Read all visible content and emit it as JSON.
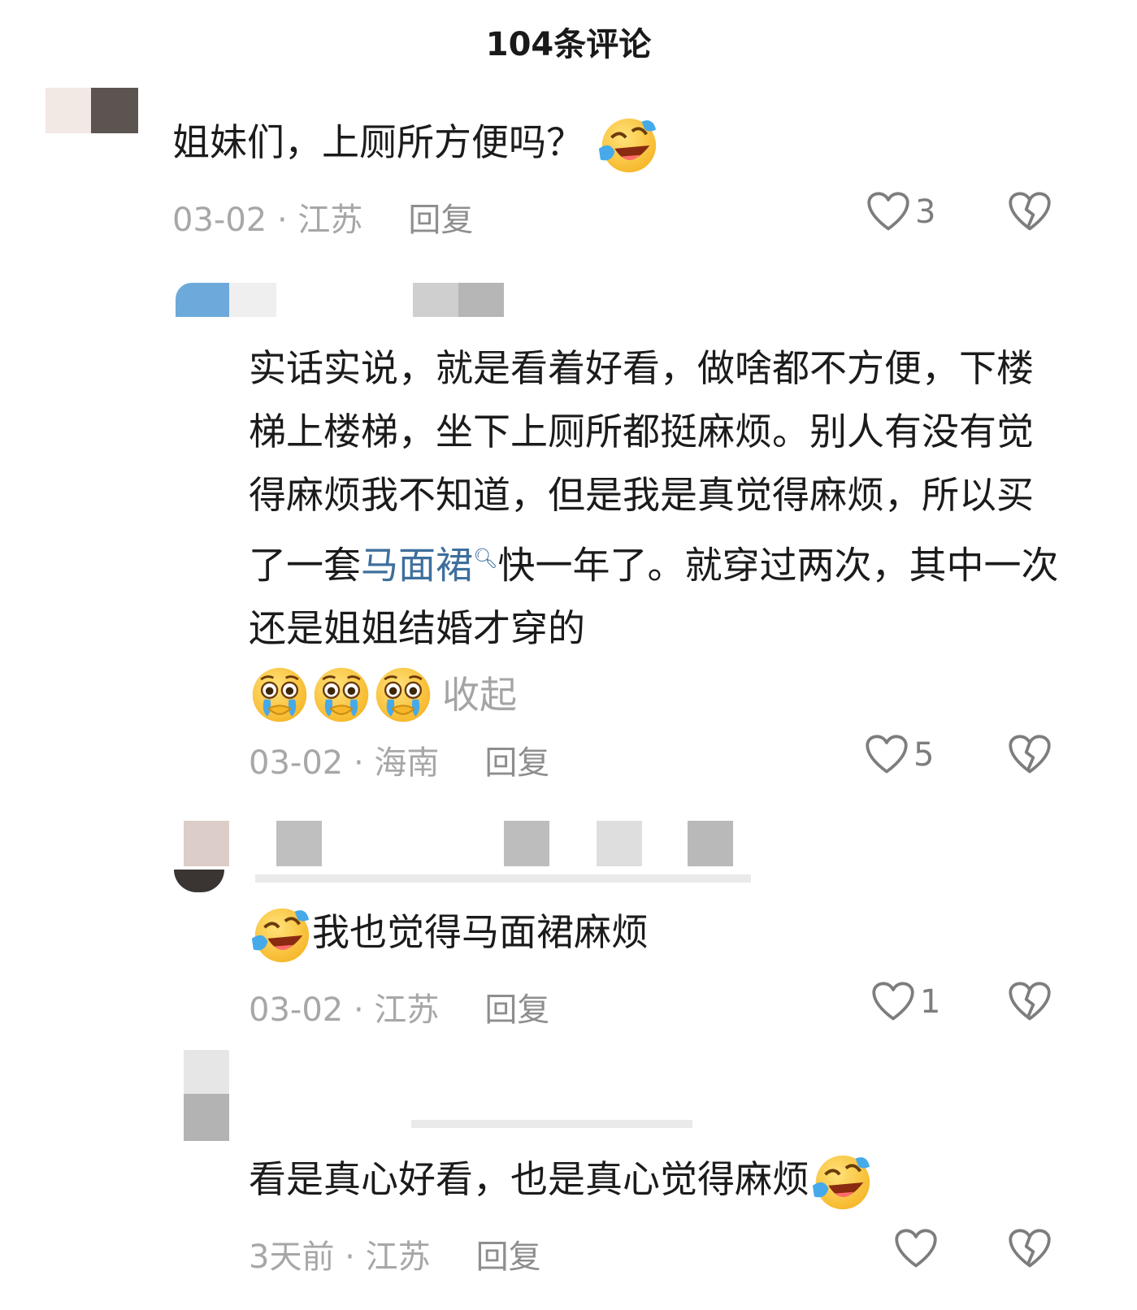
{
  "header": {
    "title": "104条评论"
  },
  "comments": [
    {
      "text": "姐妹们，上厕所方便吗？",
      "date": "03-02",
      "location": "江苏",
      "reply_label": "回复",
      "likes": "3",
      "emoji_icon": "laugh-cry-emoji-icon"
    },
    {
      "text_before": "实话实说，就是看着好看，做啥都不方便，下楼梯上楼梯，坐下上厕所都挺麻烦。别人有没有觉得麻烦我不知道，但是我是真觉得麻烦，所以买了一套",
      "link": "马面裙",
      "text_after": "快一年了。就穿过两次，其中一次还是姐姐结婚才穿的",
      "collapse_label": "收起",
      "date": "03-02",
      "location": "海南",
      "reply_label": "回复",
      "likes": "5",
      "emoji_icon": "pleading-cry-emoji-icon"
    },
    {
      "text": "我也觉得马面裙麻烦",
      "date": "03-02",
      "location": "江苏",
      "reply_label": "回复",
      "likes": "1",
      "emoji_icon": "laugh-cry-emoji-icon"
    },
    {
      "text": "看是真心好看，也是真心觉得麻烦",
      "date": "3天前",
      "location": "江苏",
      "reply_label": "回复",
      "likes": "",
      "emoji_icon": "laugh-cry-emoji-icon"
    }
  ],
  "colors": {
    "link": "#3e6f9c",
    "meta": "#a7a7a7",
    "icon": "#7d7d7d"
  }
}
